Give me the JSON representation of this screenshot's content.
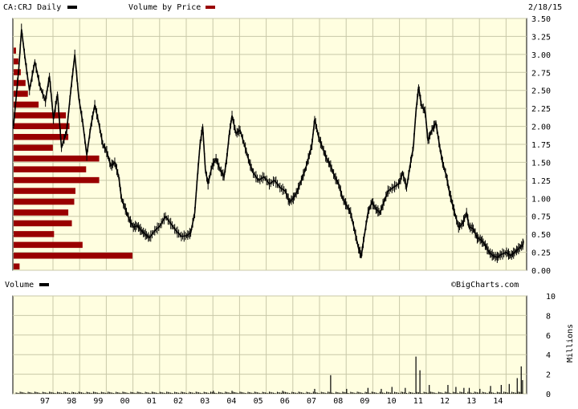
{
  "header": {
    "symbol_label": "CA:CRJ Daily",
    "vbp_label": "Volume by Price",
    "date": "2/18/15"
  },
  "volume_panel": {
    "label": "Volume",
    "credit": "©BigCharts.com",
    "unit": "Millions"
  },
  "colors": {
    "background": "#fffee0",
    "grid": "#c8c8a8",
    "price_line": "#000000",
    "volume_by_price_bar": "#990000",
    "volume_bar": "#000000"
  },
  "chart_data": [
    {
      "type": "line",
      "name": "price",
      "series_name": "CA:CRJ Daily",
      "x_ticks": [
        "97",
        "98",
        "99",
        "00",
        "01",
        "02",
        "03",
        "04",
        "05",
        "06",
        "07",
        "08",
        "09",
        "10",
        "11",
        "12",
        "13",
        "14"
      ],
      "ylim": [
        0,
        3.5
      ],
      "y_ticks": [
        "0.00",
        "0.25",
        "0.50",
        "0.75",
        "1.00",
        "1.25",
        "1.50",
        "1.75",
        "2.00",
        "2.25",
        "2.50",
        "2.75",
        "3.00",
        "3.25",
        "3.50"
      ],
      "grid": true,
      "points": [
        [
          1996.0,
          2.0
        ],
        [
          1996.2,
          2.8
        ],
        [
          1996.3,
          3.35
        ],
        [
          1996.45,
          2.9
        ],
        [
          1996.6,
          2.5
        ],
        [
          1996.8,
          2.9
        ],
        [
          1997.0,
          2.55
        ],
        [
          1997.2,
          2.35
        ],
        [
          1997.35,
          2.7
        ],
        [
          1997.5,
          2.1
        ],
        [
          1997.65,
          2.45
        ],
        [
          1997.8,
          1.7
        ],
        [
          1998.0,
          1.95
        ],
        [
          1998.15,
          2.5
        ],
        [
          1998.3,
          3.0
        ],
        [
          1998.45,
          2.4
        ],
        [
          1998.6,
          2.05
        ],
        [
          1998.75,
          1.6
        ],
        [
          1998.9,
          2.0
        ],
        [
          1999.05,
          2.3
        ],
        [
          1999.2,
          2.05
        ],
        [
          1999.35,
          1.75
        ],
        [
          1999.5,
          1.65
        ],
        [
          1999.65,
          1.45
        ],
        [
          1999.8,
          1.5
        ],
        [
          1999.95,
          1.3
        ],
        [
          2000.05,
          1.0
        ],
        [
          2000.2,
          0.85
        ],
        [
          2000.35,
          0.7
        ],
        [
          2000.5,
          0.6
        ],
        [
          2000.65,
          0.62
        ],
        [
          2000.8,
          0.55
        ],
        [
          2000.95,
          0.5
        ],
        [
          2001.1,
          0.45
        ],
        [
          2001.3,
          0.55
        ],
        [
          2001.5,
          0.62
        ],
        [
          2001.7,
          0.75
        ],
        [
          2001.9,
          0.65
        ],
        [
          2002.1,
          0.55
        ],
        [
          2002.3,
          0.47
        ],
        [
          2002.5,
          0.48
        ],
        [
          2002.65,
          0.52
        ],
        [
          2002.8,
          0.8
        ],
        [
          2002.9,
          1.3
        ],
        [
          2003.0,
          1.75
        ],
        [
          2003.1,
          2.0
        ],
        [
          2003.2,
          1.4
        ],
        [
          2003.3,
          1.2
        ],
        [
          2003.45,
          1.45
        ],
        [
          2003.6,
          1.55
        ],
        [
          2003.75,
          1.4
        ],
        [
          2003.9,
          1.3
        ],
        [
          2004.0,
          1.55
        ],
        [
          2004.1,
          1.9
        ],
        [
          2004.2,
          2.15
        ],
        [
          2004.35,
          1.9
        ],
        [
          2004.5,
          1.95
        ],
        [
          2004.7,
          1.7
        ],
        [
          2004.85,
          1.5
        ],
        [
          2005.0,
          1.35
        ],
        [
          2005.2,
          1.25
        ],
        [
          2005.4,
          1.3
        ],
        [
          2005.6,
          1.2
        ],
        [
          2005.8,
          1.25
        ],
        [
          2006.0,
          1.15
        ],
        [
          2006.2,
          1.1
        ],
        [
          2006.35,
          0.95
        ],
        [
          2006.5,
          1.0
        ],
        [
          2006.65,
          1.1
        ],
        [
          2006.8,
          1.25
        ],
        [
          2006.95,
          1.4
        ],
        [
          2007.1,
          1.6
        ],
        [
          2007.2,
          1.75
        ],
        [
          2007.3,
          2.1
        ],
        [
          2007.45,
          1.85
        ],
        [
          2007.6,
          1.7
        ],
        [
          2007.75,
          1.55
        ],
        [
          2007.9,
          1.45
        ],
        [
          2008.05,
          1.3
        ],
        [
          2008.2,
          1.2
        ],
        [
          2008.35,
          1.0
        ],
        [
          2008.5,
          0.9
        ],
        [
          2008.65,
          0.8
        ],
        [
          2008.8,
          0.55
        ],
        [
          2008.95,
          0.3
        ],
        [
          2009.05,
          0.2
        ],
        [
          2009.15,
          0.45
        ],
        [
          2009.3,
          0.8
        ],
        [
          2009.45,
          0.95
        ],
        [
          2009.6,
          0.85
        ],
        [
          2009.75,
          0.8
        ],
        [
          2009.9,
          0.95
        ],
        [
          2010.05,
          1.1
        ],
        [
          2010.25,
          1.15
        ],
        [
          2010.45,
          1.2
        ],
        [
          2010.6,
          1.35
        ],
        [
          2010.75,
          1.15
        ],
        [
          2010.9,
          1.5
        ],
        [
          2011.0,
          1.7
        ],
        [
          2011.1,
          2.2
        ],
        [
          2011.2,
          2.55
        ],
        [
          2011.3,
          2.3
        ],
        [
          2011.45,
          2.2
        ],
        [
          2011.55,
          1.8
        ],
        [
          2011.7,
          1.95
        ],
        [
          2011.85,
          2.05
        ],
        [
          2012.0,
          1.7
        ],
        [
          2012.1,
          1.5
        ],
        [
          2012.25,
          1.3
        ],
        [
          2012.35,
          1.1
        ],
        [
          2012.45,
          0.95
        ],
        [
          2012.55,
          0.8
        ],
        [
          2012.7,
          0.6
        ],
        [
          2012.85,
          0.65
        ],
        [
          2013.0,
          0.8
        ],
        [
          2013.1,
          0.6
        ],
        [
          2013.25,
          0.58
        ],
        [
          2013.4,
          0.45
        ],
        [
          2013.55,
          0.42
        ],
        [
          2013.7,
          0.35
        ],
        [
          2013.85,
          0.25
        ],
        [
          2014.0,
          0.2
        ],
        [
          2014.15,
          0.18
        ],
        [
          2014.3,
          0.22
        ],
        [
          2014.5,
          0.25
        ],
        [
          2014.65,
          0.2
        ],
        [
          2014.8,
          0.25
        ],
        [
          2014.95,
          0.3
        ],
        [
          2015.1,
          0.35
        ],
        [
          2015.14,
          0.4
        ]
      ]
    },
    {
      "type": "bar",
      "name": "volume_by_price",
      "series_name": "Volume by Price",
      "orientation": "horizontal",
      "bins": [
        {
          "price": 0.05,
          "volume": 5
        },
        {
          "price": 0.2,
          "volume": 100
        },
        {
          "price": 0.35,
          "volume": 58
        },
        {
          "price": 0.5,
          "volume": 34
        },
        {
          "price": 0.65,
          "volume": 49
        },
        {
          "price": 0.8,
          "volume": 46
        },
        {
          "price": 0.95,
          "volume": 51
        },
        {
          "price": 1.1,
          "volume": 52
        },
        {
          "price": 1.25,
          "volume": 72
        },
        {
          "price": 1.4,
          "volume": 61
        },
        {
          "price": 1.55,
          "volume": 72
        },
        {
          "price": 1.7,
          "volume": 33
        },
        {
          "price": 1.85,
          "volume": 46
        },
        {
          "price": 2.0,
          "volume": 47
        },
        {
          "price": 2.15,
          "volume": 44
        },
        {
          "price": 2.3,
          "volume": 21
        },
        {
          "price": 2.45,
          "volume": 12
        },
        {
          "price": 2.6,
          "volume": 10
        },
        {
          "price": 2.75,
          "volume": 6
        },
        {
          "price": 2.9,
          "volume": 4
        },
        {
          "price": 3.05,
          "volume": 2
        }
      ]
    },
    {
      "type": "bar",
      "name": "volume",
      "ylabel": "Millions",
      "ylim": [
        0,
        10
      ],
      "y_ticks": [
        "0",
        "2",
        "4",
        "6",
        "8",
        "10"
      ],
      "x_ticks": [
        "97",
        "98",
        "99",
        "00",
        "01",
        "02",
        "03",
        "04",
        "05",
        "06",
        "07",
        "08",
        "09",
        "10",
        "11",
        "12",
        "13",
        "14"
      ],
      "grid": true,
      "bars": [
        [
          2007.9,
          1.9
        ],
        [
          2011.1,
          3.8
        ],
        [
          2011.25,
          2.4
        ],
        [
          2012.3,
          0.9
        ],
        [
          2010.2,
          0.7
        ],
        [
          2009.3,
          0.6
        ],
        [
          2008.5,
          0.5
        ],
        [
          2011.6,
          0.9
        ],
        [
          2012.6,
          0.7
        ],
        [
          2013.1,
          0.6
        ],
        [
          2013.9,
          0.8
        ],
        [
          2014.3,
          0.9
        ],
        [
          2014.6,
          1.0
        ],
        [
          2014.9,
          1.6
        ],
        [
          2015.05,
          2.8
        ],
        [
          2015.1,
          1.4
        ],
        [
          2003.5,
          0.3
        ],
        [
          2004.2,
          0.3
        ],
        [
          2006.1,
          0.3
        ],
        [
          2007.3,
          0.5
        ],
        [
          2010.7,
          0.6
        ],
        [
          2012.9,
          0.6
        ],
        [
          2013.5,
          0.5
        ],
        [
          2009.8,
          0.5
        ]
      ]
    }
  ]
}
